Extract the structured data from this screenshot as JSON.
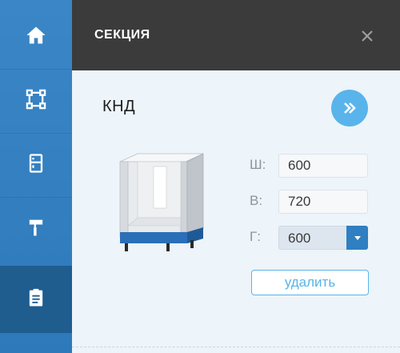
{
  "rail": {
    "items": [
      {
        "icon": "home-icon"
      },
      {
        "icon": "room-layout-icon"
      },
      {
        "icon": "cabinet-icon"
      },
      {
        "icon": "paint-roller-icon"
      },
      {
        "icon": "clipboard-icon",
        "active": true
      }
    ]
  },
  "panel": {
    "title": "СЕКЦИЯ",
    "close_icon": "close-icon"
  },
  "section": {
    "name": "КНД",
    "next_icon": "double-chevron-right-icon"
  },
  "dimensions": {
    "width_label": "Ш:",
    "width_value": "600",
    "height_label": "В:",
    "height_value": "720",
    "depth_label": "Г:",
    "depth_value": "600"
  },
  "actions": {
    "delete_label": "удалить"
  },
  "colors": {
    "rail": "#3a86c6",
    "rail_active": "#1f5d8f",
    "header": "#3b3b3b",
    "accent": "#58b4ea",
    "select_arrow": "#2f7fc2"
  }
}
